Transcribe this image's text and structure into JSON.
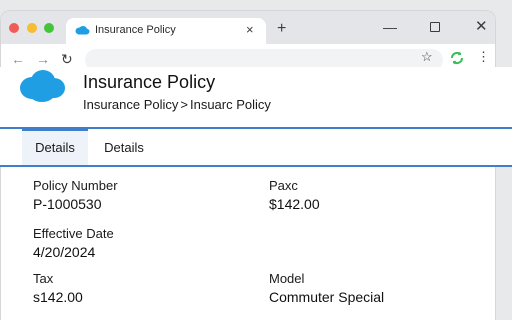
{
  "browser": {
    "tab_title": "Insurance Policy",
    "tab_close": "×",
    "new_tab": "+",
    "window_controls": {
      "minimize": "—",
      "close": "✕"
    },
    "nav": {
      "back": "←",
      "forward": "→",
      "reload": "↻"
    },
    "bookmark": "☆",
    "menu": "⋮",
    "icons": [
      "salesforce-cloud-icon",
      "back-arrow-icon",
      "forward-arrow-icon",
      "reload-icon",
      "star-icon",
      "sync-extension-icon",
      "kebab-menu-icon"
    ],
    "colors": {
      "close_dot": "#ee5e56",
      "minimize_dot": "#f5bd2f",
      "zoom_dot": "#44c43a",
      "extension": "#3dbb5a"
    }
  },
  "header": {
    "title": "Insurance Policy",
    "breadcrumb": {
      "parent": "Insurance Policy",
      "separator": ">",
      "current": "Insuarc Policy"
    }
  },
  "tabs": [
    {
      "label": "Details",
      "active": true
    },
    {
      "label": "Details",
      "active": false
    }
  ],
  "fields": {
    "policy_number": {
      "label": "Policy Number",
      "value": "P-1000530"
    },
    "paxc": {
      "label": "Paxc",
      "value": "$142.00"
    },
    "effective_date": {
      "label": "Effective Date",
      "value": "4/20/2024"
    },
    "tax": {
      "label": "Tax",
      "value": "s142.00"
    },
    "model": {
      "label": "Model",
      "value": "Commuter Special"
    }
  },
  "colors": {
    "accent": "#3f7ecb",
    "brand_cloud": "#1f9ee3",
    "active_tab_bg": "#eef3f9"
  }
}
